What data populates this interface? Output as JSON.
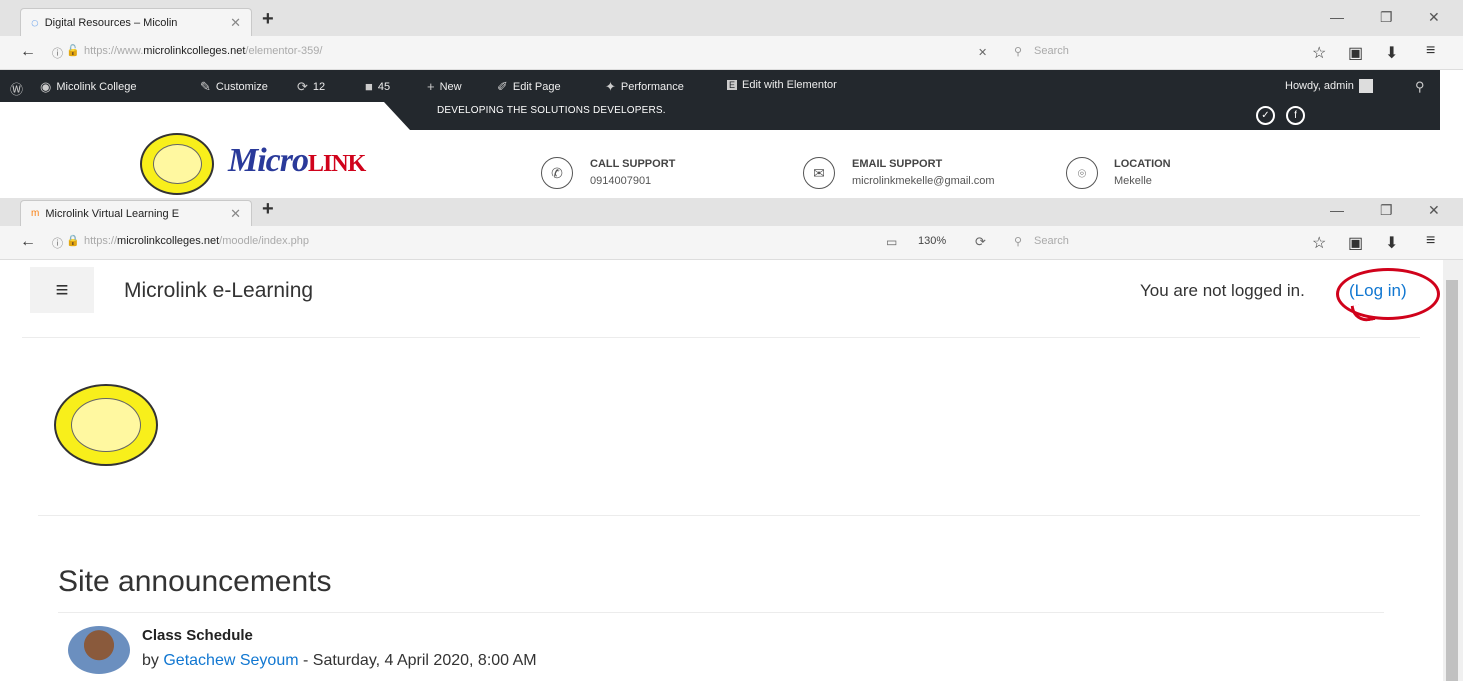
{
  "browser1": {
    "tab_title": "Digital Resources – Micolin",
    "url_prefix": "https://www.",
    "url_domain": "microlinkcolleges.net",
    "url_path": "/elementor-359/",
    "search_placeholder": "Search"
  },
  "wp_admin_bar": {
    "site_name": "Micolink College",
    "customize": "Customize",
    "updates_count": "12",
    "comments_count": "45",
    "new": "New",
    "edit_page": "Edit Page",
    "performance": "Performance",
    "edit_elementor": "Edit with Elementor",
    "howdy": "Howdy, admin"
  },
  "site_header": {
    "tagline": "DEVELOPING THE SOLUTIONS DEVELOPERS.",
    "logo_text": "MicroLINK",
    "call_support_title": "CALL SUPPORT",
    "call_support_value": "0914007901",
    "email_support_title": "EMAIL SUPPORT",
    "email_support_value": "microlinkmekelle@gmail.com",
    "location_title": "LOCATION",
    "location_value": "Mekelle"
  },
  "browser2": {
    "tab_title": "Microlink Virtual Learning E",
    "url_prefix": "https://",
    "url_domain": "microlinkcolleges.net",
    "url_path": "/moodle/index.php",
    "zoom": "130%",
    "search_placeholder": "Search"
  },
  "moodle": {
    "site_title": "Microlink e-Learning",
    "not_logged_in": "You are not logged in.",
    "login_link": "(Log in)",
    "section_title": "Site announcements",
    "post_title": "Class Schedule",
    "post_by_prefix": "by",
    "post_author": "Getachew Seyoum",
    "post_date": "- Saturday, 4 April 2020, 8:00 AM"
  },
  "colors": {
    "admin_bar": "#23282d",
    "link": "#1177d1",
    "annotation": "#d0021b",
    "logo_yellow": "#f8ef1b"
  }
}
